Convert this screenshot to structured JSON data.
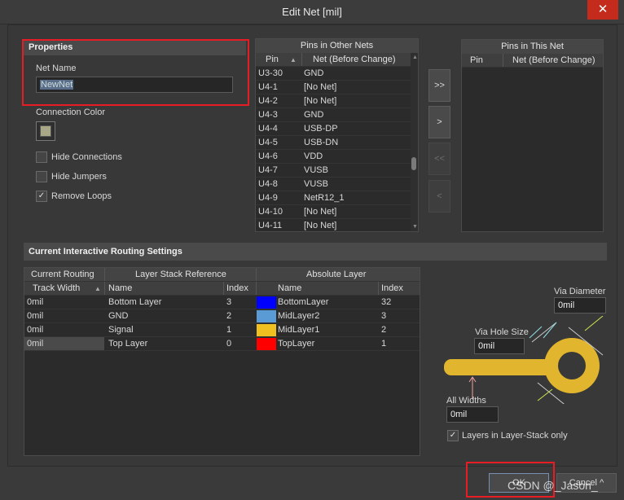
{
  "window": {
    "title": "Edit Net [mil]",
    "close_glyph": "✕"
  },
  "properties": {
    "header": "Properties",
    "net_name_label": "Net Name",
    "net_name_value": "NewNet",
    "connection_color_label": "Connection Color",
    "connection_color": "#a8a888",
    "options": [
      {
        "label": "Hide Connections",
        "checked": false
      },
      {
        "label": "Hide Jumpers",
        "checked": false
      },
      {
        "label": "Remove Loops",
        "checked": true
      }
    ]
  },
  "pins_other": {
    "header": "Pins in Other Nets",
    "col_pin": "Pin",
    "col_net": "Net (Before Change)",
    "rows": [
      {
        "pin": "U3-30",
        "net": "GND"
      },
      {
        "pin": "U4-1",
        "net": "[No Net]"
      },
      {
        "pin": "U4-2",
        "net": "[No Net]"
      },
      {
        "pin": "U4-3",
        "net": "GND"
      },
      {
        "pin": "U4-4",
        "net": "USB-DP"
      },
      {
        "pin": "U4-5",
        "net": "USB-DN"
      },
      {
        "pin": "U4-6",
        "net": "VDD"
      },
      {
        "pin": "U4-7",
        "net": "VUSB"
      },
      {
        "pin": "U4-8",
        "net": "VUSB"
      },
      {
        "pin": "U4-9",
        "net": "NetR12_1"
      },
      {
        "pin": "U4-10",
        "net": "[No Net]"
      },
      {
        "pin": "U4-11",
        "net": "[No Net]"
      }
    ]
  },
  "transfer_buttons": [
    {
      "label": ">>",
      "enabled": true
    },
    {
      "label": ">",
      "enabled": true
    },
    {
      "label": "<<",
      "enabled": false
    },
    {
      "label": "<",
      "enabled": false
    }
  ],
  "pins_this": {
    "header": "Pins in This Net",
    "col_pin": "Pin",
    "col_net": "Net (Before Change)"
  },
  "routing": {
    "header": "Current Interactive Routing Settings",
    "group_current": "Current Routing",
    "group_stack": "Layer Stack Reference",
    "group_abs": "Absolute Layer",
    "col_track": "Track Width",
    "col_name": "Name",
    "col_index": "Index",
    "col_abs_name": "Name",
    "col_abs_index": "Index",
    "rows": [
      {
        "width": "0mil",
        "name": "Bottom Layer",
        "index": "3",
        "color": "#0000ff",
        "abs_name": "BottomLayer",
        "abs_index": "32"
      },
      {
        "width": "0mil",
        "name": "GND",
        "index": "2",
        "color": "#5b9bd5",
        "abs_name": "MidLayer2",
        "abs_index": "3"
      },
      {
        "width": "0mil",
        "name": "Signal",
        "index": "1",
        "color": "#f0c020",
        "abs_name": "MidLayer1",
        "abs_index": "2"
      },
      {
        "width": "0mil",
        "name": "Top Layer",
        "index": "0",
        "color": "#ff0000",
        "abs_name": "TopLayer",
        "abs_index": "1"
      }
    ]
  },
  "via": {
    "diameter_label": "Via Diameter",
    "diameter_value": "0mil",
    "hole_label": "Via Hole Size",
    "hole_value": "0mil",
    "widths_label": "All Widths",
    "widths_value": "0mil",
    "layer_stack_only_label": "Layers in Layer-Stack only",
    "layer_stack_only_checked": true,
    "pad_color": "#e2b52e"
  },
  "footer": {
    "ok_label": "OK",
    "cancel_label": "Cancel",
    "watermark": "CSDN @_Jason_"
  }
}
